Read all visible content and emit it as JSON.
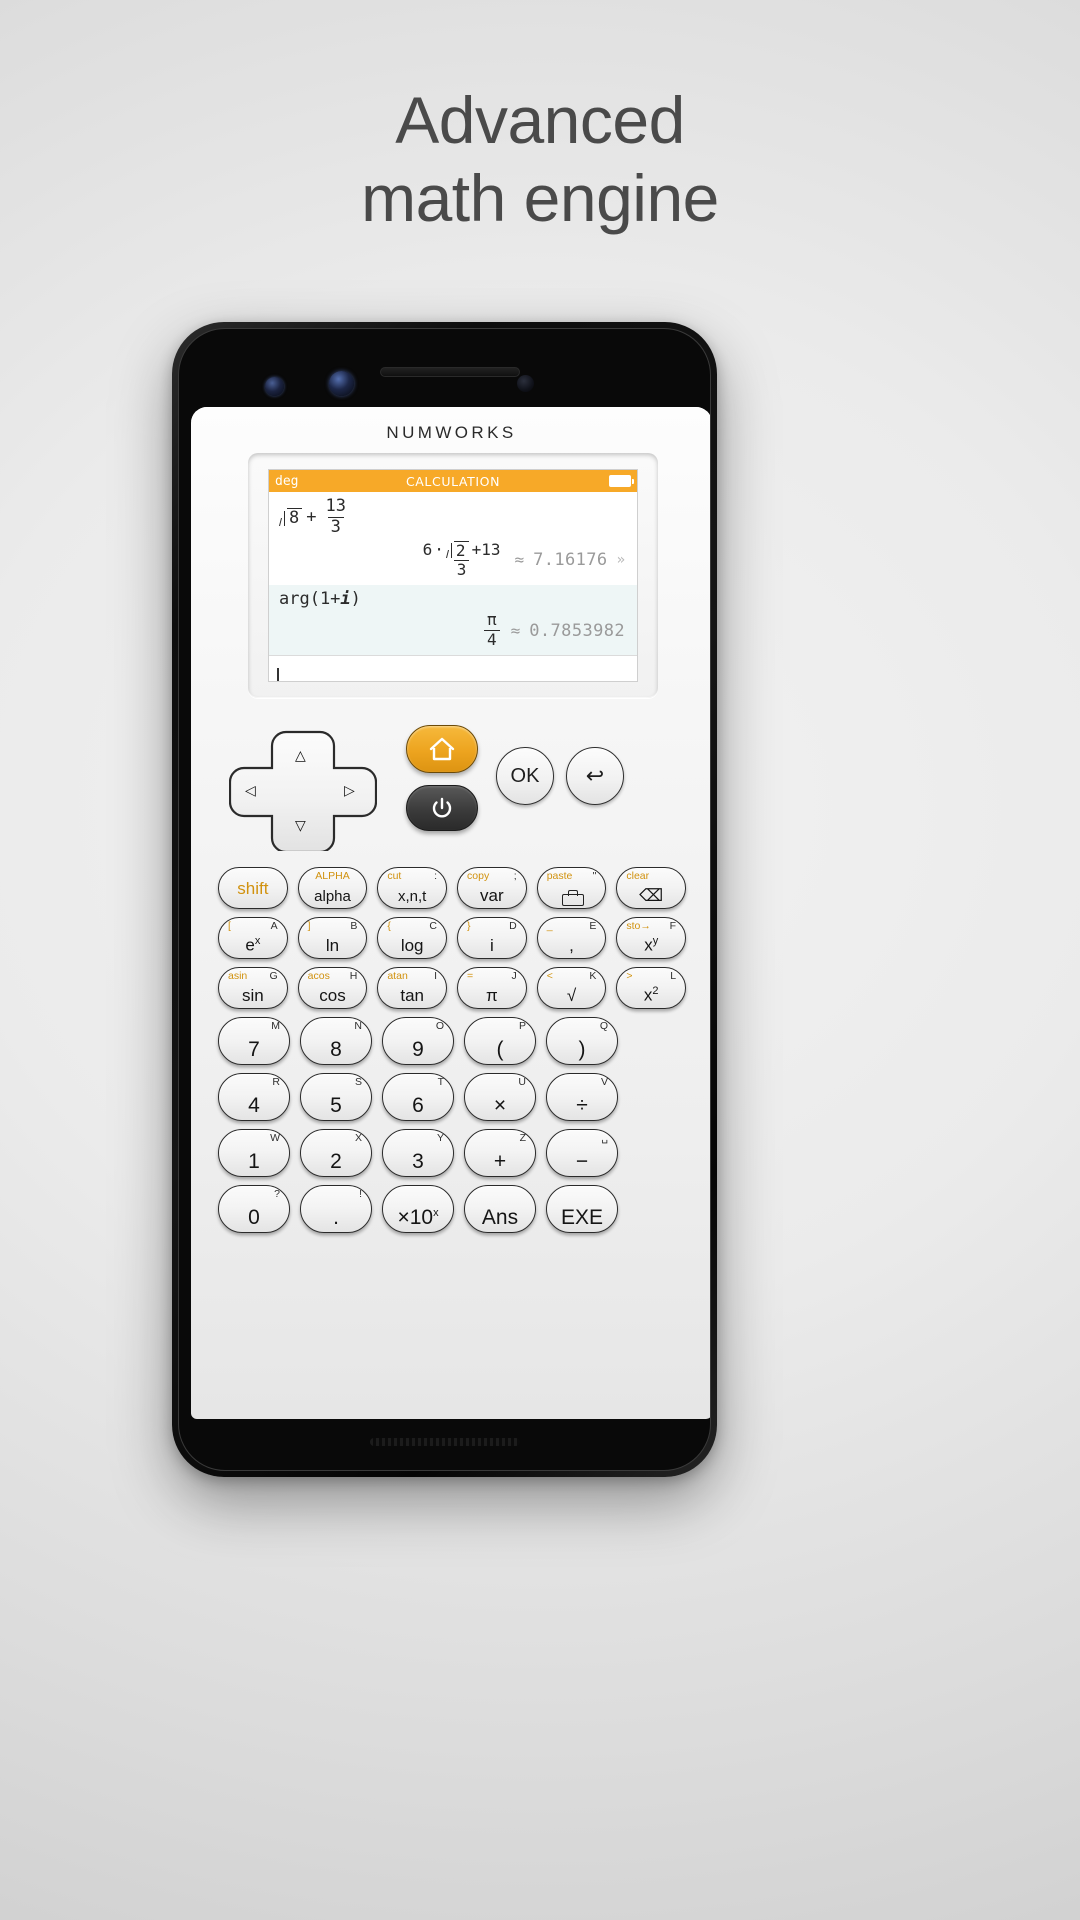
{
  "headline": {
    "line1": "Advanced",
    "line2": "math engine"
  },
  "device": {
    "brand": "NUMWORKS"
  },
  "screen": {
    "status": {
      "angle_mode": "deg",
      "app_title": "CALCULATION",
      "battery_icon": "battery-full-icon"
    },
    "calculations": [
      {
        "input": "√8 + 13/3",
        "input_parts": {
          "radicand": "8",
          "plus": "+",
          "frac_num": "13",
          "frac_den": "3"
        },
        "exact_result": "(6·√2 + 13)/3",
        "exact_parts": {
          "coef": "6",
          "dot": "·",
          "radicand": "2",
          "plus": "+13",
          "den": "3"
        },
        "approx_symbol": "≈",
        "approx_value": "7.16176",
        "expand_icon": "»"
      },
      {
        "input": "arg(1+i)",
        "input_parts": {
          "fn": "arg(1+",
          "imag": "i",
          "close": ")"
        },
        "exact_parts": {
          "num": "π",
          "den": "4"
        },
        "approx_symbol": "≈",
        "approx_value": "0.7853982"
      }
    ],
    "editline": {
      "value": ""
    }
  },
  "keypad": {
    "dpad": {
      "up": "△",
      "down": "▽",
      "left": "◁",
      "right": "▷"
    },
    "home_label": "home-icon",
    "power_label": "power-icon",
    "ok_label": "OK",
    "back_label": "↩",
    "rows": [
      [
        {
          "name": "shift",
          "main": "shift",
          "style": "shift-only"
        },
        {
          "name": "alpha",
          "main": "alpha",
          "shift": "ALPHA",
          "shift_center": true
        },
        {
          "name": "x-n-t",
          "main": "x,n,t",
          "shift": "cut",
          "alpha": ":"
        },
        {
          "name": "var",
          "main": "var",
          "shift": "copy",
          "alpha": ";"
        },
        {
          "name": "toolbox",
          "main": "",
          "shift": "paste",
          "alpha": "\"",
          "icon": "toolbox-icon"
        },
        {
          "name": "backspace",
          "main": "⌫",
          "shift": "clear"
        }
      ],
      [
        {
          "name": "exp",
          "main": "e",
          "sup": "x",
          "shift": "[",
          "alpha": "A"
        },
        {
          "name": "ln",
          "main": "ln",
          "shift": "]",
          "alpha": "B"
        },
        {
          "name": "log",
          "main": "log",
          "shift": "{",
          "alpha": "C"
        },
        {
          "name": "imaginary",
          "main": "i",
          "shift": "}",
          "alpha": "D"
        },
        {
          "name": "comma",
          "main": ",",
          "shift": "_",
          "alpha": "E"
        },
        {
          "name": "power",
          "main": "x",
          "sup": "y",
          "shift": "sto→",
          "alpha": "F"
        }
      ],
      [
        {
          "name": "sin",
          "main": "sin",
          "shift": "asin",
          "alpha": "G"
        },
        {
          "name": "cos",
          "main": "cos",
          "shift": "acos",
          "alpha": "H"
        },
        {
          "name": "tan",
          "main": "tan",
          "shift": "atan",
          "alpha": "I"
        },
        {
          "name": "pi",
          "main": "π",
          "shift": "=",
          "alpha": "J"
        },
        {
          "name": "sqrt",
          "main": "√",
          "shift": "<",
          "alpha": "K"
        },
        {
          "name": "square",
          "main": "x",
          "sup": "2",
          "shift": ">",
          "alpha": "L"
        }
      ],
      [
        {
          "name": "seven",
          "main": "7",
          "alpha": "M"
        },
        {
          "name": "eight",
          "main": "8",
          "alpha": "N"
        },
        {
          "name": "nine",
          "main": "9",
          "alpha": "O"
        },
        {
          "name": "paren-open",
          "main": "(",
          "alpha": "P"
        },
        {
          "name": "paren-close",
          "main": ")",
          "alpha": "Q"
        }
      ],
      [
        {
          "name": "four",
          "main": "4",
          "alpha": "R"
        },
        {
          "name": "five",
          "main": "5",
          "alpha": "S"
        },
        {
          "name": "six",
          "main": "6",
          "alpha": "T"
        },
        {
          "name": "multiply",
          "main": "×",
          "alpha": "U"
        },
        {
          "name": "divide",
          "main": "÷",
          "alpha": "V"
        }
      ],
      [
        {
          "name": "one",
          "main": "1",
          "alpha": "W"
        },
        {
          "name": "two",
          "main": "2",
          "alpha": "X"
        },
        {
          "name": "three",
          "main": "3",
          "alpha": "Y"
        },
        {
          "name": "plus",
          "main": "+",
          "alpha": "Z"
        },
        {
          "name": "minus",
          "main": "−",
          "alpha": "␣"
        }
      ],
      [
        {
          "name": "zero",
          "main": "0",
          "alpha": "?"
        },
        {
          "name": "decimal-point",
          "main": ".",
          "alpha": "!"
        },
        {
          "name": "power-of-ten",
          "main": "×10",
          "sup": "x"
        },
        {
          "name": "ans",
          "main": "Ans"
        },
        {
          "name": "exe",
          "main": "EXE"
        }
      ]
    ]
  }
}
